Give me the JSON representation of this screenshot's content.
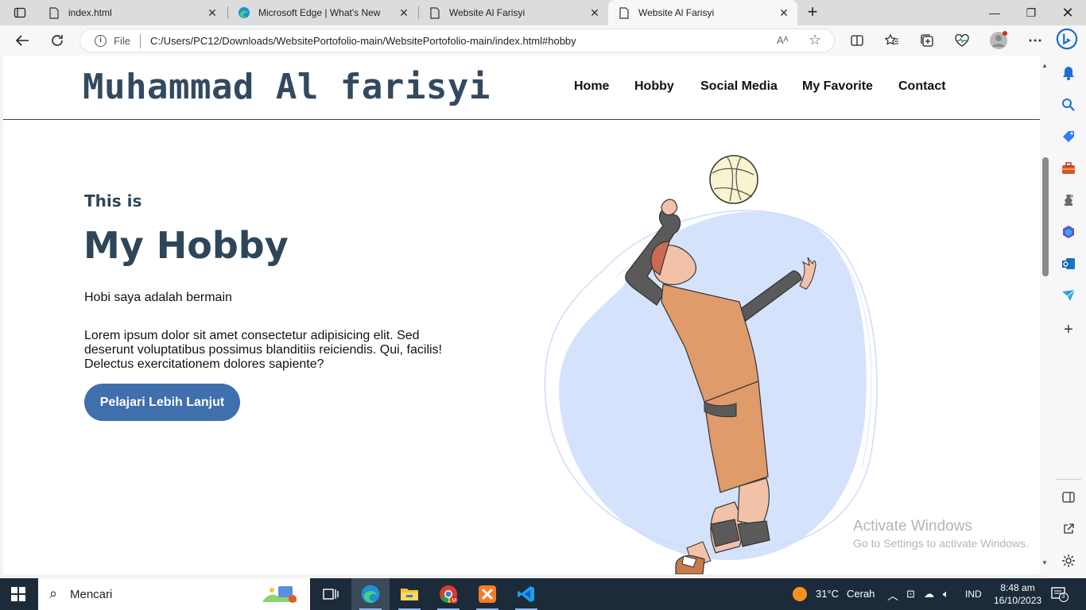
{
  "browser": {
    "tabs": [
      {
        "label": "index.html",
        "icon": "file-icon"
      },
      {
        "label": "Microsoft Edge | What's New",
        "icon": "edge-icon"
      },
      {
        "label": "Website Al Farisyi",
        "icon": "file-icon"
      },
      {
        "label": "Website Al Farisyi",
        "icon": "file-icon",
        "active": true
      }
    ],
    "address": {
      "scheme_label": "File",
      "url": "C:/Users/PC12/Downloads/WebsitePortofolio-main/WebsitePortofolio-main/index.html#hobby",
      "read_aloud": "Aᴬ"
    }
  },
  "site": {
    "brand": "Muhammad Al farisyi",
    "nav": [
      "Home",
      "Hobby",
      "Social Media",
      "My Favorite",
      "Contact"
    ],
    "hero": {
      "subtitle": "This is",
      "title": "My Hobby",
      "intro": "Hobi saya adalah bermain",
      "body": "Lorem ipsum dolor sit amet consectetur adipisicing elit. Sed deserunt voluptatibus possimus blanditiis reiciendis. Qui, facilis! Delectus exercitationem dolores sapiente?",
      "cta": "Pelajari Lebih Lanjut"
    },
    "colors": {
      "accent": "#3f6fad",
      "heading": "#2d4659",
      "blob": "#d5e2fc"
    }
  },
  "watermark": {
    "line1": "Activate Windows",
    "line2": "Go to Settings to activate Windows."
  },
  "taskbar": {
    "search_placeholder": "Mencari",
    "weather": {
      "temp": "31°C",
      "condition": "Cerah"
    },
    "language": "IND",
    "time": "8:48 am",
    "date": "16/10/2023",
    "notification_count": "3"
  }
}
